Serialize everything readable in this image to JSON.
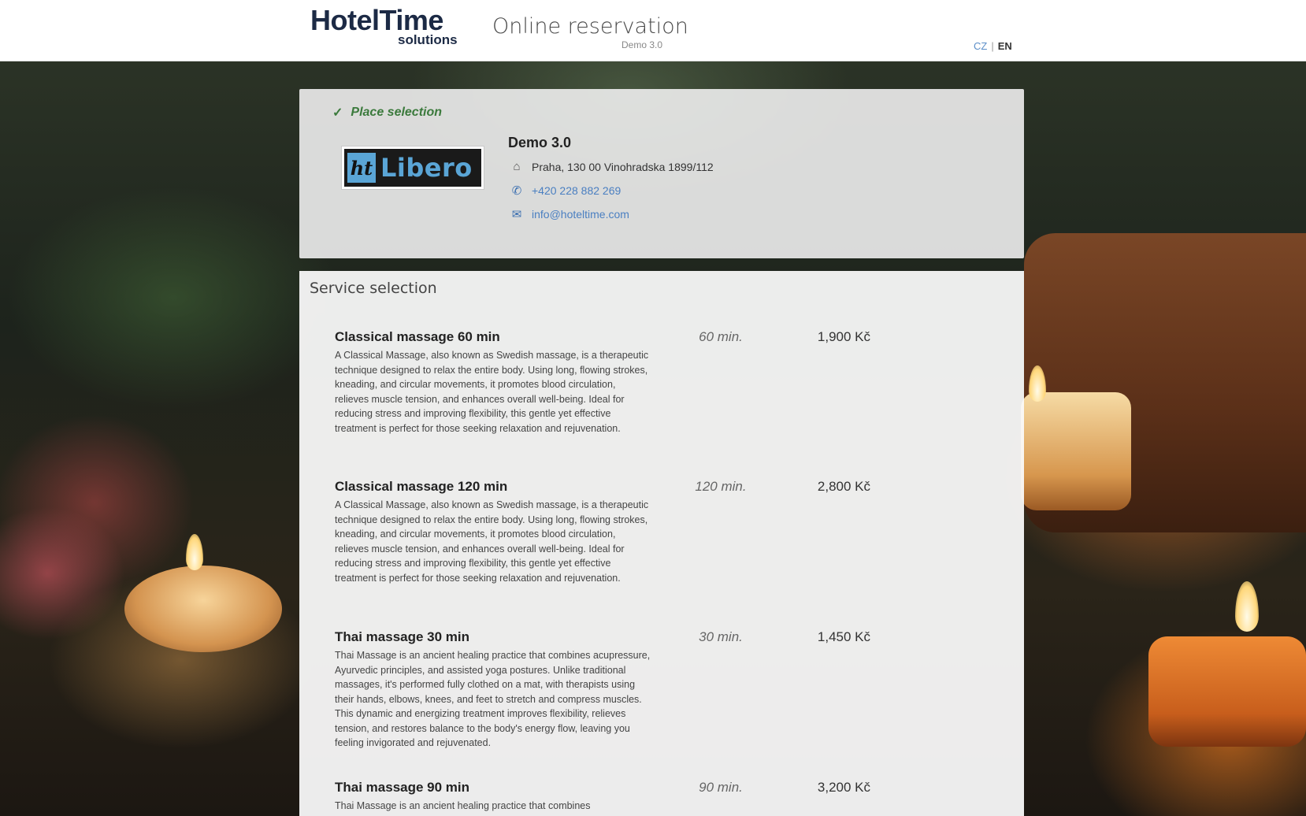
{
  "header": {
    "logo_main": "HotelTime",
    "logo_sub": "solutions",
    "title": "Online reservation",
    "version": "Demo 3.0",
    "lang_cz": "CZ",
    "lang_sep": "|",
    "lang_en": "EN"
  },
  "place": {
    "heading": "Place selection",
    "logo_ht": "ht",
    "logo_name": "Libero",
    "name": "Demo 3.0",
    "address": "Praha, 130 00 Vinohradska 1899/112",
    "phone": "+420 228 882 269",
    "email": "info@hoteltime.com"
  },
  "services": {
    "title": "Service selection",
    "items": [
      {
        "name": "Classical massage 60 min",
        "duration": "60 min.",
        "price": "1,900 Kč",
        "description": "A Classical Massage, also known as Swedish massage, is a therapeutic technique designed to relax the entire body. Using long, flowing strokes, kneading, and circular movements, it promotes blood circulation, relieves muscle tension, and enhances overall well-being. Ideal for reducing stress and improving flexibility, this gentle yet effective treatment is perfect for those seeking relaxation and rejuvenation."
      },
      {
        "name": "Classical massage 120 min",
        "duration": "120 min.",
        "price": "2,800 Kč",
        "description": "A Classical Massage, also known as Swedish massage, is a therapeutic technique designed to relax the entire body. Using long, flowing strokes, kneading, and circular movements, it promotes blood circulation, relieves muscle tension, and enhances overall well-being. Ideal for reducing stress and improving flexibility, this gentle yet effective treatment is perfect for those seeking relaxation and rejuvenation."
      },
      {
        "name": "Thai massage 30 min",
        "duration": "30 min.",
        "price": "1,450 Kč",
        "description": "Thai Massage is an ancient healing practice that combines acupressure, Ayurvedic principles, and assisted yoga postures. Unlike traditional massages, it's performed fully clothed on a mat, with therapists using their hands, elbows, knees, and feet to stretch and compress muscles. This dynamic and energizing treatment improves flexibility, relieves tension, and restores balance to the body's energy flow, leaving you feeling invigorated and rejuvenated."
      },
      {
        "name": "Thai massage 90 min",
        "duration": "90 min.",
        "price": "3,200 Kč",
        "description": "Thai Massage is an ancient healing practice that combines"
      }
    ]
  },
  "icons": {
    "check": "check-icon",
    "home": "home-icon",
    "phone": "phone-icon",
    "mail": "mail-icon"
  },
  "colors": {
    "brand_navy": "#1c2a45",
    "success_green": "#3b7a3c",
    "link_blue": "#4a7fc1",
    "libero_blue": "#5aa5d6"
  }
}
